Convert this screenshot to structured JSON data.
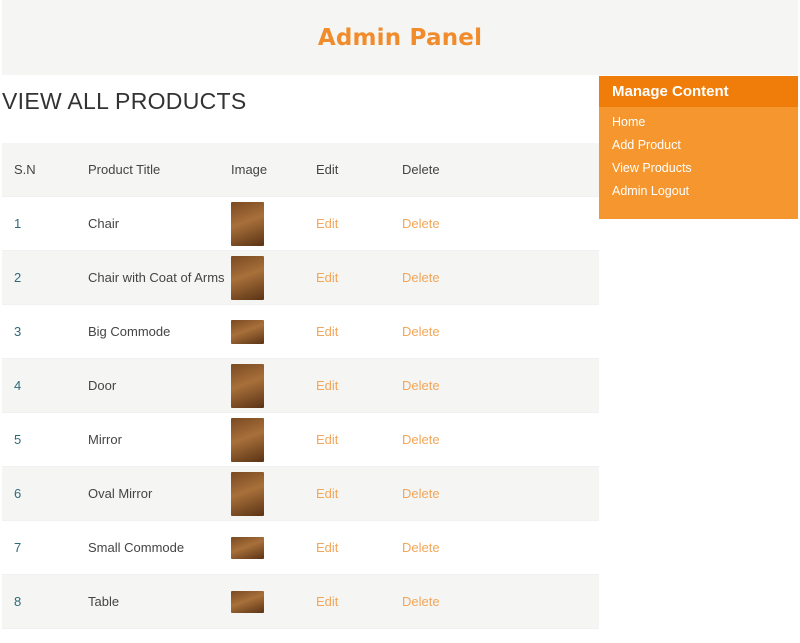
{
  "header": {
    "title": "Admin Panel"
  },
  "page": {
    "heading": "VIEW ALL PRODUCTS"
  },
  "table": {
    "columns": [
      "S.N",
      "Product Title",
      "Image",
      "Edit",
      "Delete"
    ],
    "rows": [
      {
        "sn": "1",
        "title": "Chair",
        "edit": "Edit",
        "delete": "Delete"
      },
      {
        "sn": "2",
        "title": "Chair with Coat of Arms",
        "edit": "Edit",
        "delete": "Delete"
      },
      {
        "sn": "3",
        "title": "Big Commode",
        "edit": "Edit",
        "delete": "Delete"
      },
      {
        "sn": "4",
        "title": "Door",
        "edit": "Edit",
        "delete": "Delete"
      },
      {
        "sn": "5",
        "title": "Mirror",
        "edit": "Edit",
        "delete": "Delete"
      },
      {
        "sn": "6",
        "title": "Oval Mirror",
        "edit": "Edit",
        "delete": "Delete"
      },
      {
        "sn": "7",
        "title": "Small Commode",
        "edit": "Edit",
        "delete": "Delete"
      },
      {
        "sn": "8",
        "title": "Table",
        "edit": "Edit",
        "delete": "Delete"
      }
    ]
  },
  "sidebar": {
    "title": "Manage Content",
    "items": [
      {
        "label": "Home"
      },
      {
        "label": "Add Product"
      },
      {
        "label": "View Products"
      },
      {
        "label": "Admin Logout"
      }
    ]
  },
  "colors": {
    "accent": "#f08c2c",
    "sidebar_bg": "#f6962f",
    "sidebar_header_bg": "#f07d0a",
    "link": "#f2a65a"
  }
}
